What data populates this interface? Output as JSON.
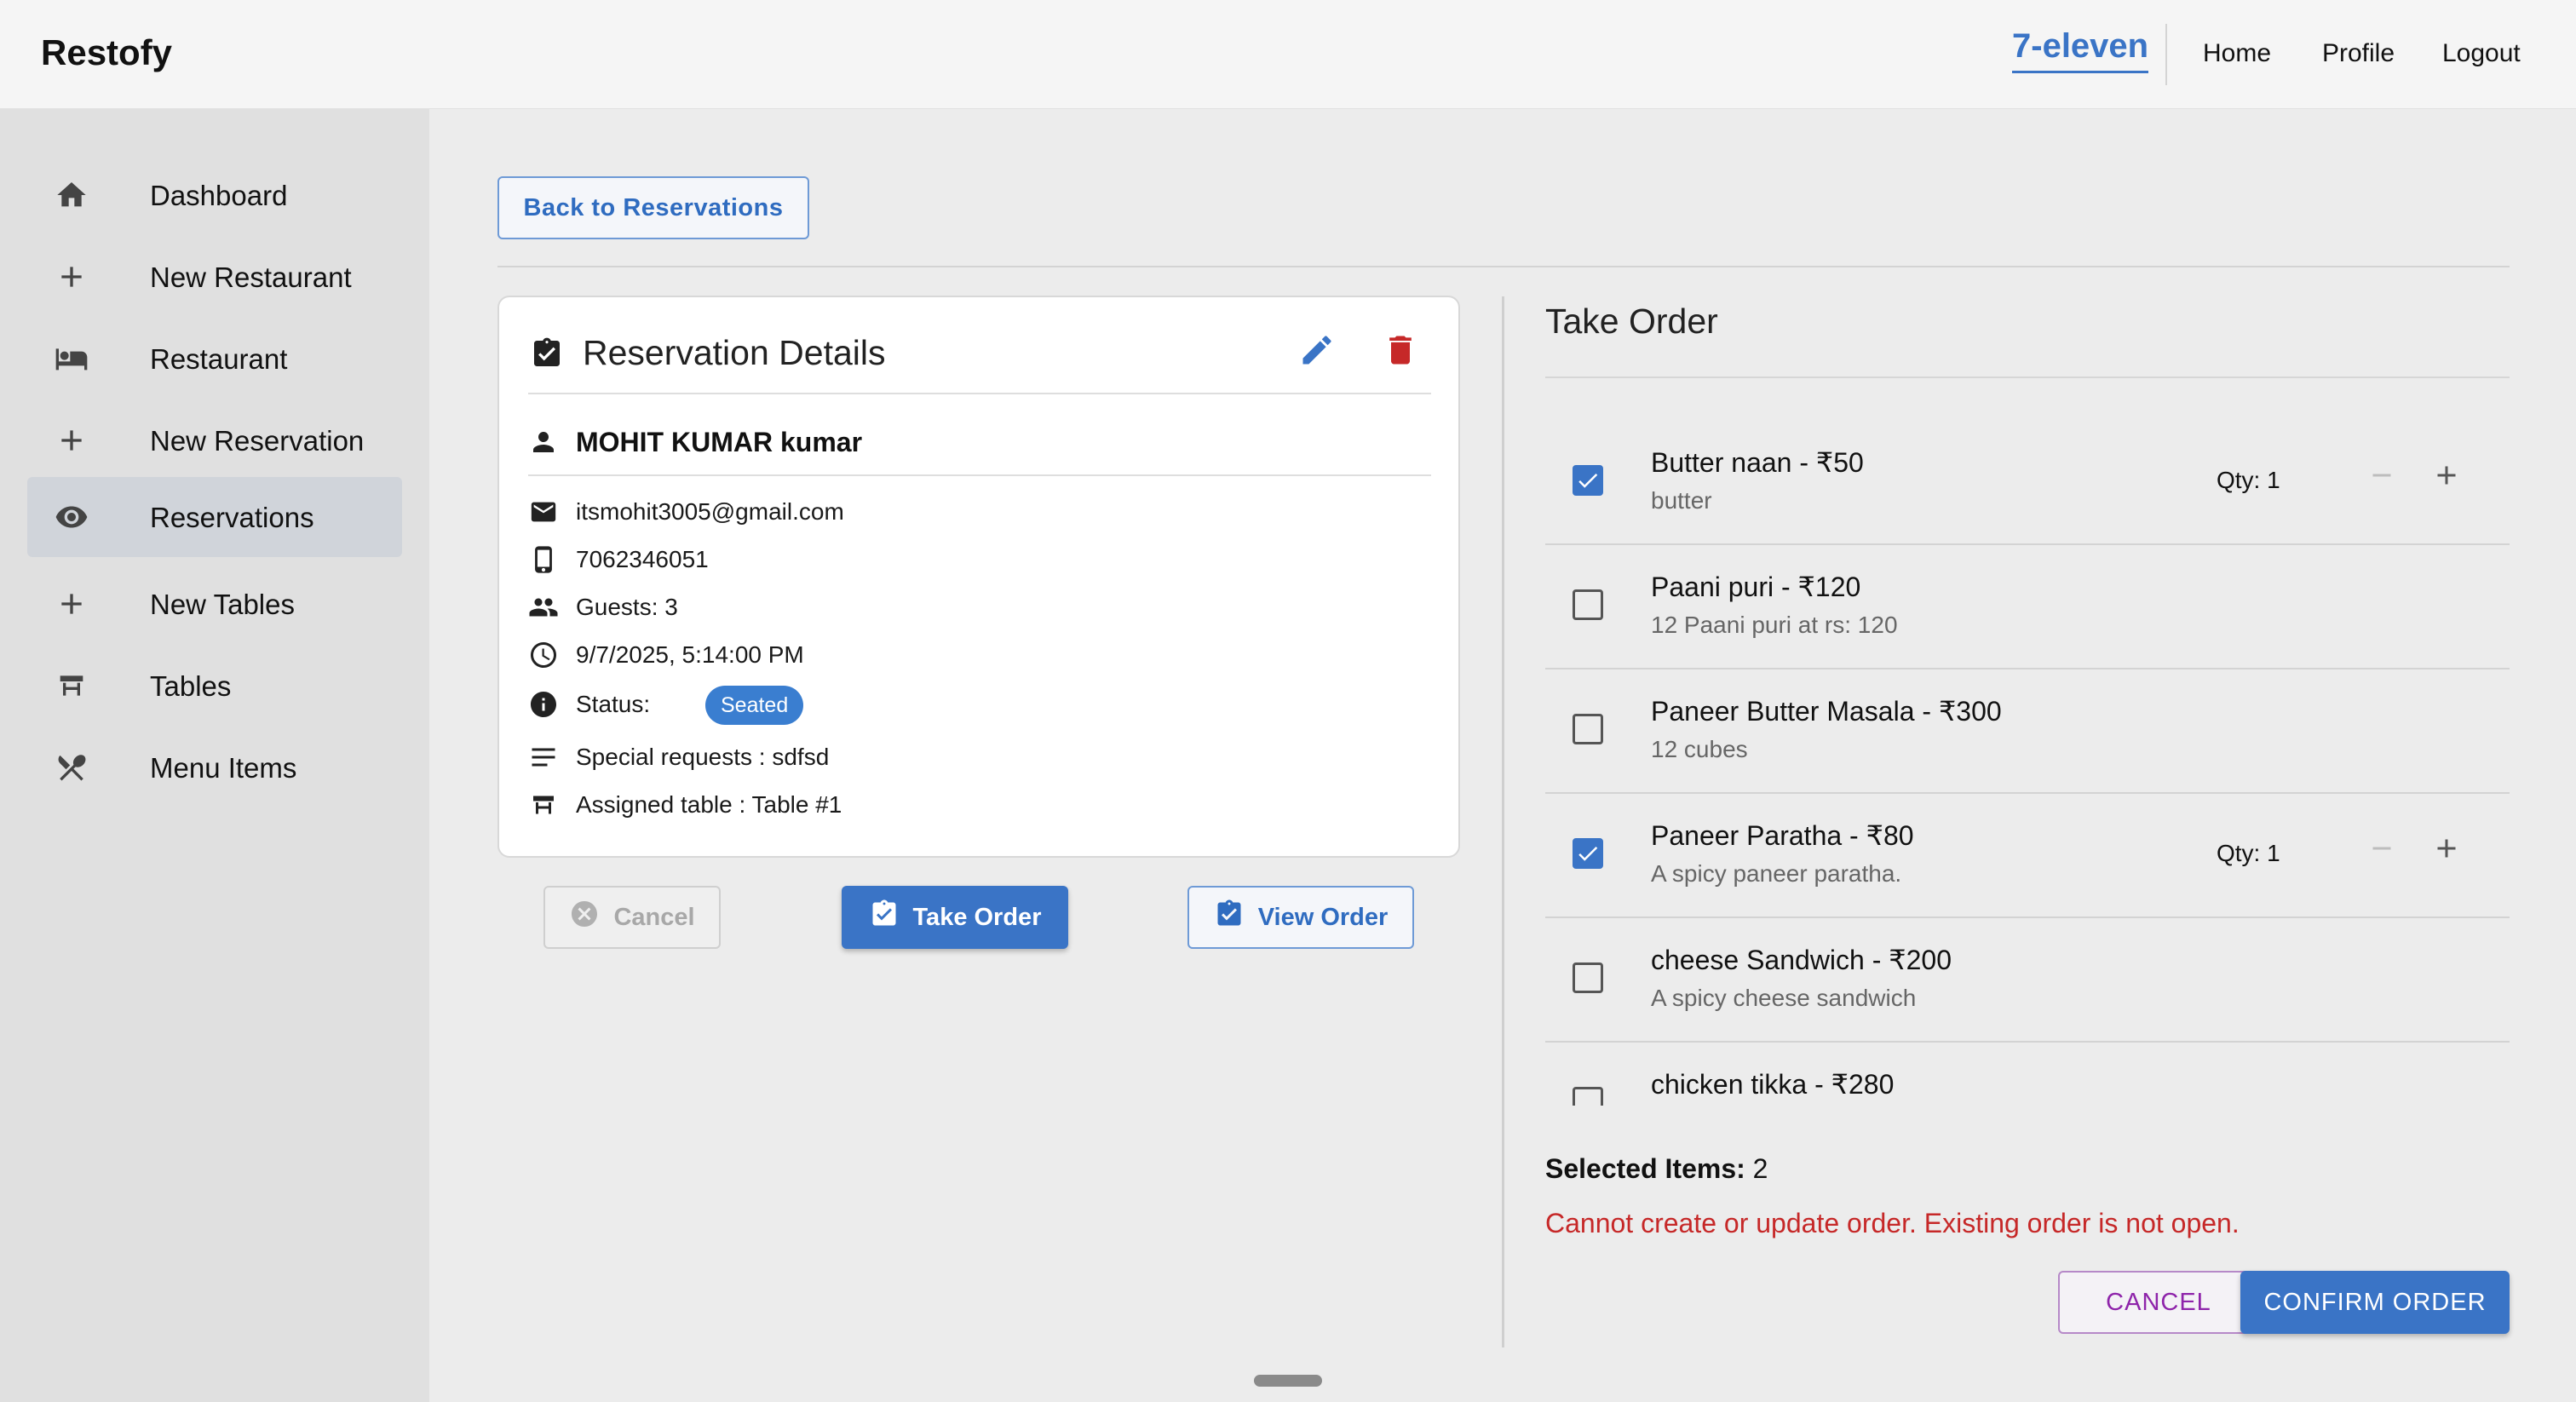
{
  "header": {
    "brand": "Restofy",
    "restaurant_name": "7-eleven",
    "nav": {
      "home": "Home",
      "profile": "Profile",
      "logout": "Logout"
    }
  },
  "sidebar": {
    "items": [
      {
        "label": "Dashboard",
        "icon": "home-icon"
      },
      {
        "label": "New Restaurant",
        "icon": "plus-icon"
      },
      {
        "label": "Restaurant",
        "icon": "bed-icon"
      },
      {
        "label": "New Reservation",
        "icon": "plus-icon"
      },
      {
        "label": "Reservations",
        "icon": "eye-icon",
        "active": true
      },
      {
        "label": "New Tables",
        "icon": "plus-icon"
      },
      {
        "label": "Tables",
        "icon": "table-icon"
      },
      {
        "label": "Menu Items",
        "icon": "utensils-icon"
      }
    ]
  },
  "main": {
    "back_label": "Back to Reservations",
    "reservation": {
      "title": "Reservation Details",
      "guest_name": "MOHIT KUMAR kumar",
      "email": "itsmohit3005@gmail.com",
      "phone": "7062346051",
      "guests": "Guests: 3",
      "datetime": "9/7/2025, 5:14:00 PM",
      "status_label": "Status:",
      "status": "Seated",
      "special_requests": "Special requests : sdfsd",
      "assigned_table": "Assigned table : Table #1"
    },
    "actions": {
      "cancel": "Cancel",
      "take_order": "Take Order",
      "view_order": "View Order"
    }
  },
  "order": {
    "title": "Take Order",
    "items": [
      {
        "name": "Butter naan - ₹50",
        "desc": "butter",
        "checked": true,
        "qty": "Qty: 1"
      },
      {
        "name": "Paani puri - ₹120",
        "desc": "12 Paani puri at rs: 120",
        "checked": false
      },
      {
        "name": "Paneer Butter Masala - ₹300",
        "desc": "12 cubes",
        "checked": false
      },
      {
        "name": "Paneer Paratha - ₹80",
        "desc": "A spicy paneer paratha.",
        "checked": true,
        "qty": "Qty: 1"
      },
      {
        "name": "cheese Sandwich - ₹200",
        "desc": "A spicy cheese sandwich",
        "checked": false
      },
      {
        "name": "chicken tikka - ₹280",
        "desc": "",
        "checked": false
      }
    ],
    "selected_label": "Selected Items:",
    "selected_count": "2",
    "error": "Cannot create or update order. Existing order is not open.",
    "cancel_label": "CANCEL",
    "confirm_label": "CONFIRM ORDER"
  },
  "colors": {
    "accent": "#3a74c6",
    "danger": "#c62828",
    "cancel_purple": "#8e24aa"
  }
}
